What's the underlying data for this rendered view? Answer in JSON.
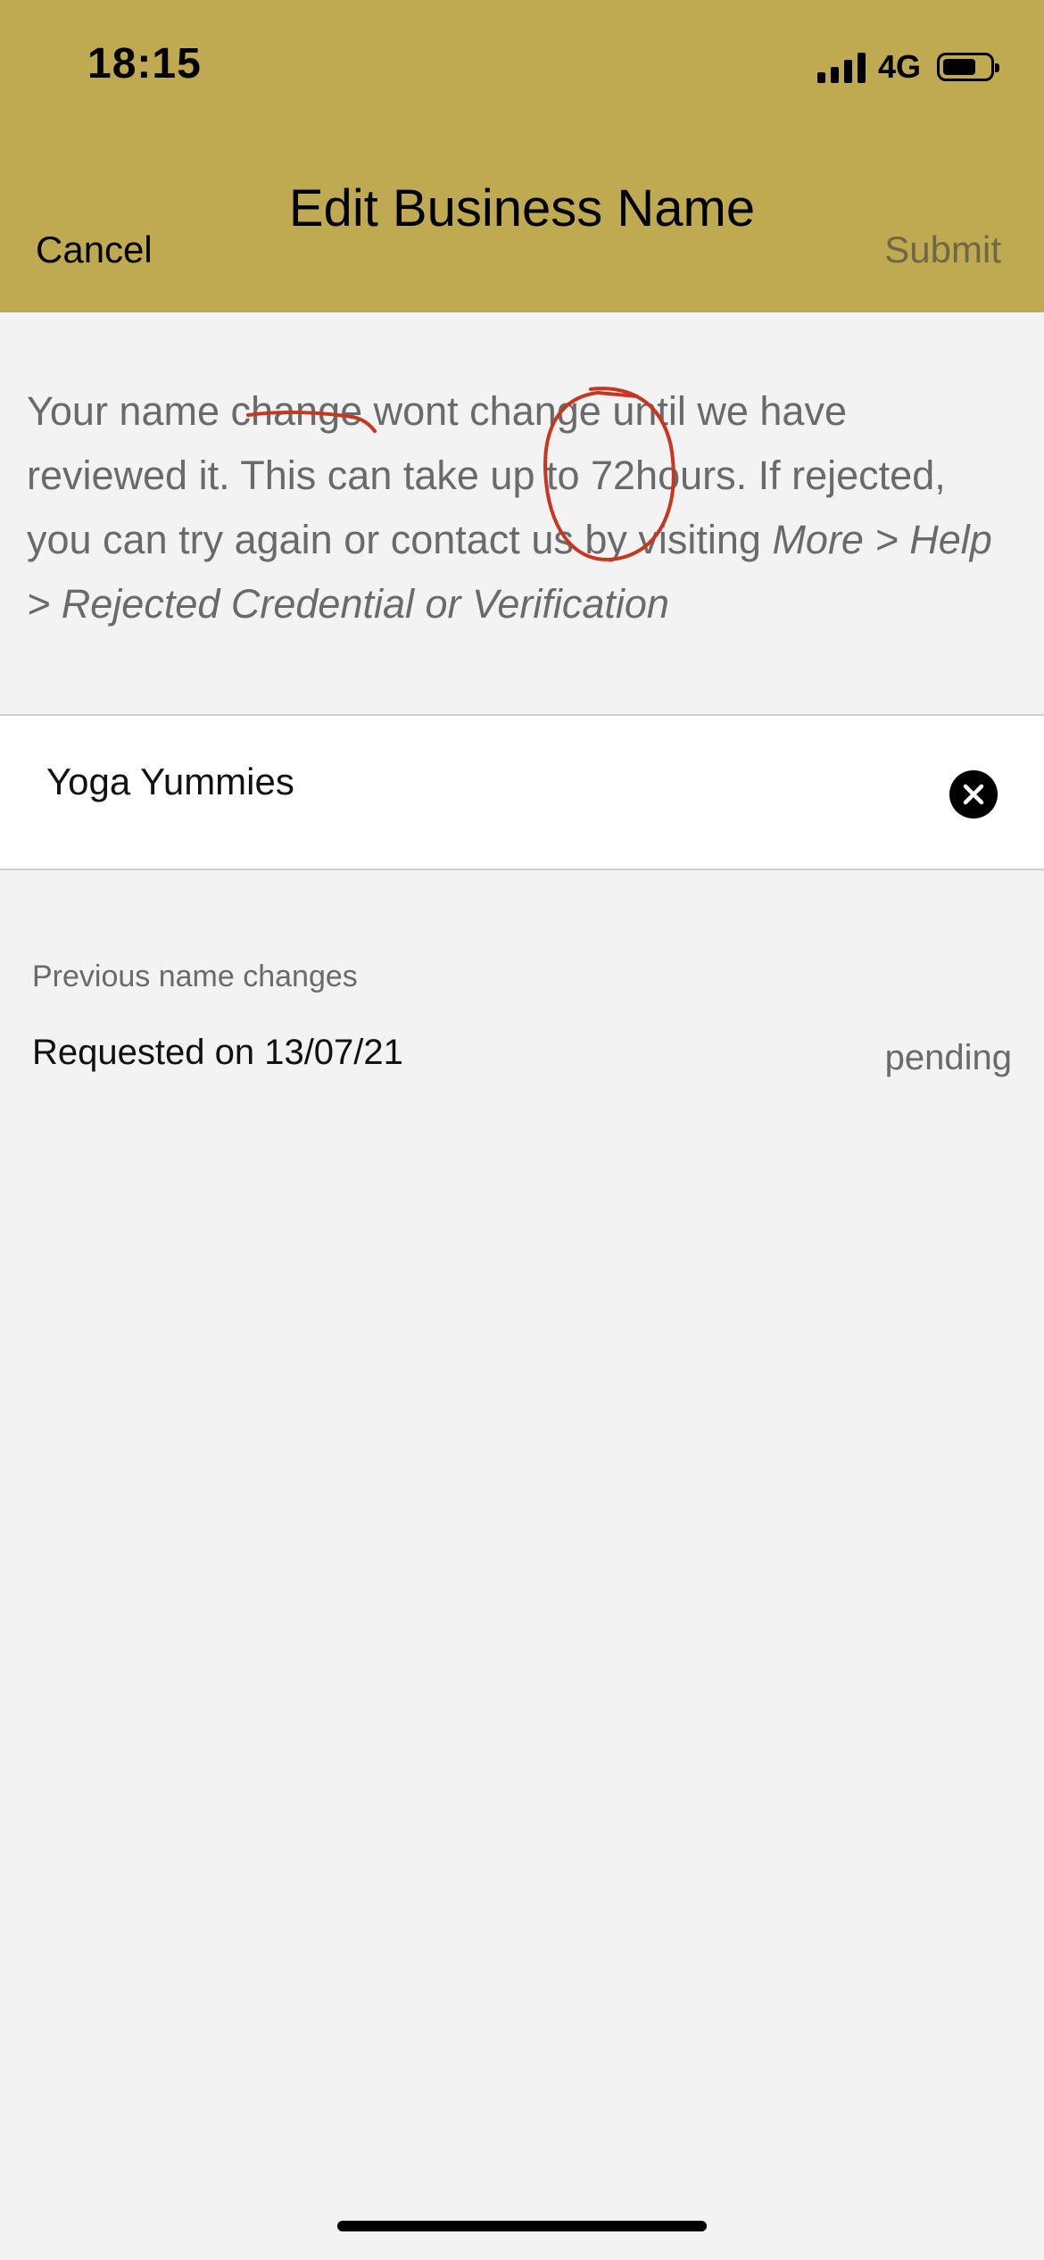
{
  "status_bar": {
    "time": "18:15",
    "network": "4G",
    "signal_icon": "cellular-signal-icon",
    "battery_icon": "battery-icon"
  },
  "nav": {
    "title": "Edit Business Name",
    "cancel_label": "Cancel",
    "submit_label": "Submit"
  },
  "info": {
    "text_main": "Your name change wont change until we have reviewed it. This can take up to 72hours. If rejected, you can try again or contact us by visiting ",
    "text_path": "More > Help > Rejected Credential or Verification"
  },
  "name_field": {
    "value": "Yoga Yummies",
    "clear_icon": "clear-icon"
  },
  "previous_changes": {
    "label": "Previous name changes",
    "items": [
      {
        "date_text": "Requested on 13/07/21",
        "status": "pending"
      }
    ]
  },
  "colors": {
    "header_bg": "#bfaa52",
    "page_bg": "#f3f3f3",
    "annotation_red": "#c8361f"
  }
}
